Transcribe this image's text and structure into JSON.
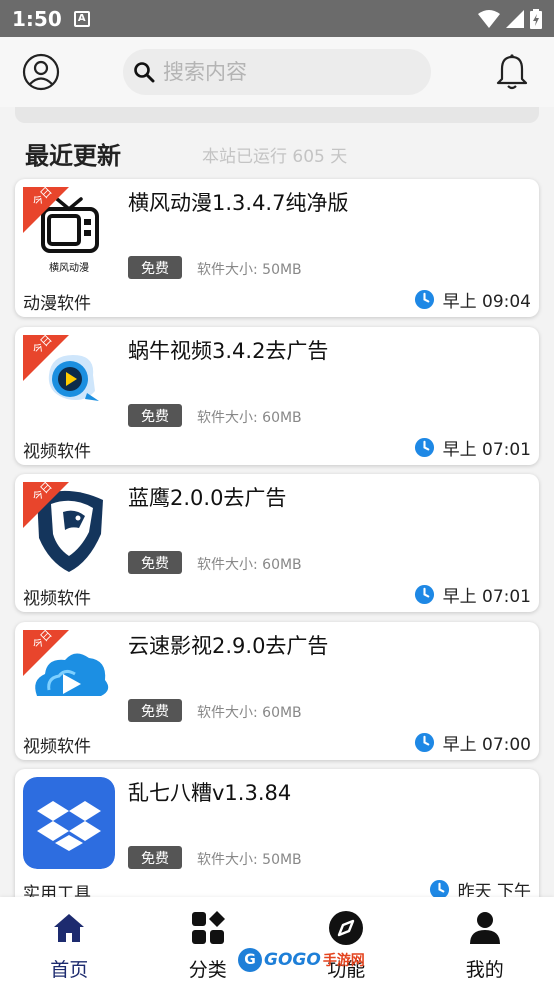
{
  "status": {
    "time": "1:50",
    "notif_letter": "A"
  },
  "header": {
    "search_placeholder": "搜索内容"
  },
  "section": {
    "title": "最近更新",
    "run_days": "本站已运行 605 天"
  },
  "tag_text": "今日",
  "items": [
    {
      "title": "横风动漫1.3.4.7纯净版",
      "badge": "免费",
      "size": "软件大小: 50MB",
      "category": "动漫软件",
      "time": "早上 09:04",
      "icon_caption": "横风动漫"
    },
    {
      "title": "蜗牛视频3.4.2去广告",
      "badge": "免费",
      "size": "软件大小: 60MB",
      "category": "视频软件",
      "time": "早上 07:01"
    },
    {
      "title": "蓝鹰2.0.0去广告",
      "badge": "免费",
      "size": "软件大小: 60MB",
      "category": "视频软件",
      "time": "早上 07:01"
    },
    {
      "title": "云速影视2.9.0去广告",
      "badge": "免费",
      "size": "软件大小: 60MB",
      "category": "视频软件",
      "time": "早上 07:00"
    },
    {
      "title": "乱七八糟v1.3.84",
      "badge": "免费",
      "size": "软件大小: 50MB",
      "category": "实用工具",
      "time": "昨天 下午"
    }
  ],
  "nav": [
    {
      "label": "首页"
    },
    {
      "label": "分类"
    },
    {
      "label": "功能"
    },
    {
      "label": "我的"
    }
  ],
  "watermark": {
    "logo": "G",
    "text": "GOGO",
    "sub": "手游网"
  },
  "colors": {
    "accent": "#1d2b6f",
    "tag_red": "#e8452c",
    "clock_blue": "#1e88e5",
    "badge_gray": "#555555"
  }
}
